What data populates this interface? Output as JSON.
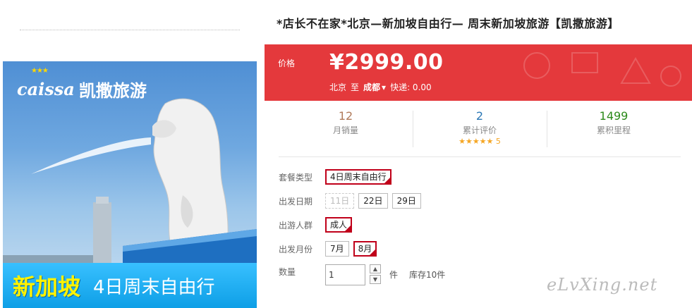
{
  "promo": {
    "brand_mark": "caissa",
    "brand_name": "凯撒旅游",
    "banner_big": "新加坡",
    "banner_small": "4日周末自由行"
  },
  "product": {
    "title": "*店长不在家*北京—新加坡自由行— 周末新加坡旅游【凯撒旅游】",
    "price_label": "价格",
    "price": "¥2999.00",
    "route": {
      "origin": "北京",
      "to": "至",
      "destination": "成都",
      "shipping": "快递: 0.00"
    },
    "stats": {
      "monthly_sales": {
        "value": "12",
        "label": "月销量"
      },
      "reviews": {
        "value": "2",
        "label": "累计评价",
        "stars": "★★★★★",
        "score": "5"
      },
      "mileage": {
        "value": "1499",
        "label": "累积里程"
      }
    },
    "package_type": {
      "label": "套餐类型",
      "option": "4日周末自由行"
    },
    "departure_date": {
      "label": "出发日期",
      "options": [
        "11日",
        "22日",
        "29日"
      ]
    },
    "traveler_type": {
      "label": "出游人群",
      "option": "成人"
    },
    "departure_month": {
      "label": "出发月份",
      "options": [
        "7月",
        "8月"
      ]
    },
    "quantity": {
      "label": "数量",
      "value": "1",
      "unit": "件",
      "stock": "库存10件"
    }
  },
  "watermark": "eLvXing.net",
  "colors": {
    "price_bg": "#e4393c",
    "selected_border": "#c0001a",
    "banner_bg": "#0e9fe6"
  }
}
